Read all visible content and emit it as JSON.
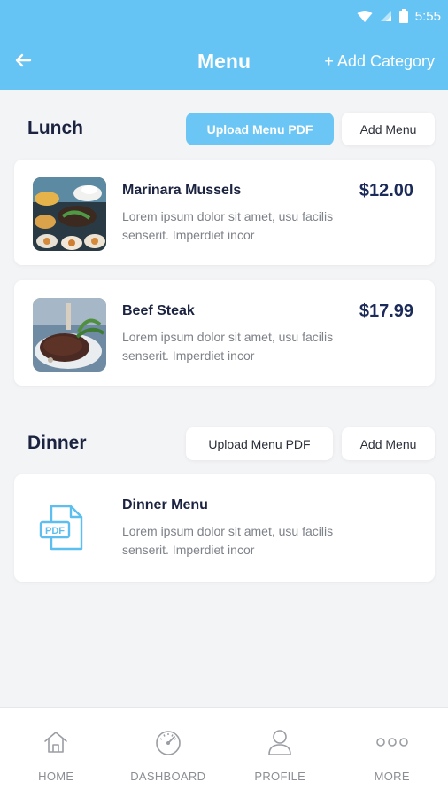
{
  "status_bar": {
    "time": "5:55"
  },
  "header": {
    "title": "Menu",
    "add_category": "+ Add Category",
    "back_icon": "arrow-left-icon"
  },
  "sections": [
    {
      "title": "Lunch",
      "upload_label": "Upload Menu PDF",
      "add_label": "Add Menu",
      "upload_active": true,
      "items": [
        {
          "name": "Marinara Mussels",
          "description": "Lorem ipsum dolor sit amet, usu facilis senserit. Imperdiet incor",
          "price": "$12.00"
        },
        {
          "name": "Beef Steak",
          "description": "Lorem ipsum dolor sit amet, usu facilis senserit. Imperdiet incor",
          "price": "$17.99"
        }
      ]
    },
    {
      "title": "Dinner",
      "upload_label": "Upload Menu PDF",
      "add_label": "Add Menu",
      "upload_active": false,
      "items": [
        {
          "name": "Dinner Menu",
          "description": "Lorem ipsum dolor sit amet, usu facilis senserit. Imperdiet incor",
          "icon": "pdf-file-icon"
        }
      ]
    }
  ],
  "bottom_nav": [
    {
      "label": "HOME",
      "icon": "home-icon"
    },
    {
      "label": "DASHBOARD",
      "icon": "dashboard-gauge-icon"
    },
    {
      "label": "PROFILE",
      "icon": "profile-icon"
    },
    {
      "label": "MORE",
      "icon": "more-dots-icon"
    }
  ],
  "colors": {
    "header_bg": "#66c4f4",
    "accent_button": "#6cc6f5",
    "page_bg": "#f3f4f6",
    "price_text": "#1b2a58"
  }
}
